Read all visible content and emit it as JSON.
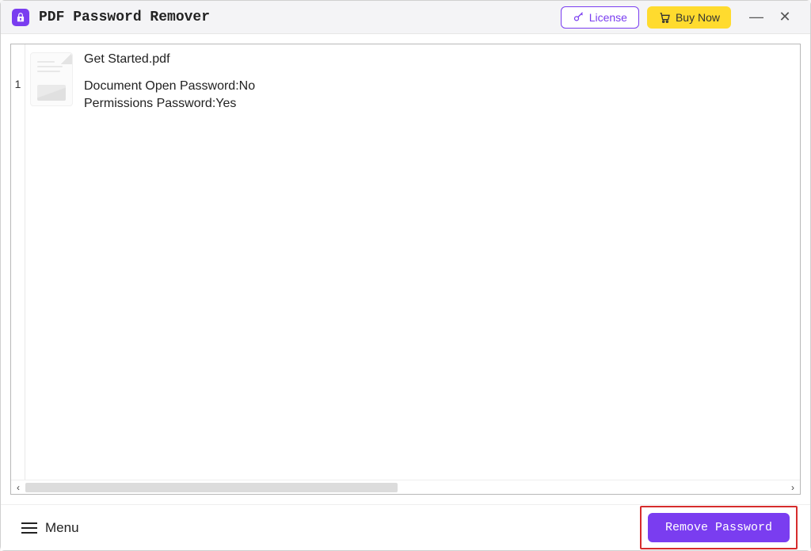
{
  "titlebar": {
    "app_title": "PDF Password Remover",
    "license_label": "License",
    "buy_label": "Buy Now"
  },
  "files": [
    {
      "index": "1",
      "name": "Get Started.pdf",
      "open_password_label": "Document Open Password:",
      "open_password_value": "No",
      "permissions_password_label": "Permissions Password:",
      "permissions_password_value": "Yes"
    }
  ],
  "bottombar": {
    "menu_label": "Menu",
    "remove_label": "Remove Password"
  },
  "colors": {
    "accent": "#7a3df0",
    "buy": "#ffdb2e",
    "highlight": "#d62c2c"
  }
}
